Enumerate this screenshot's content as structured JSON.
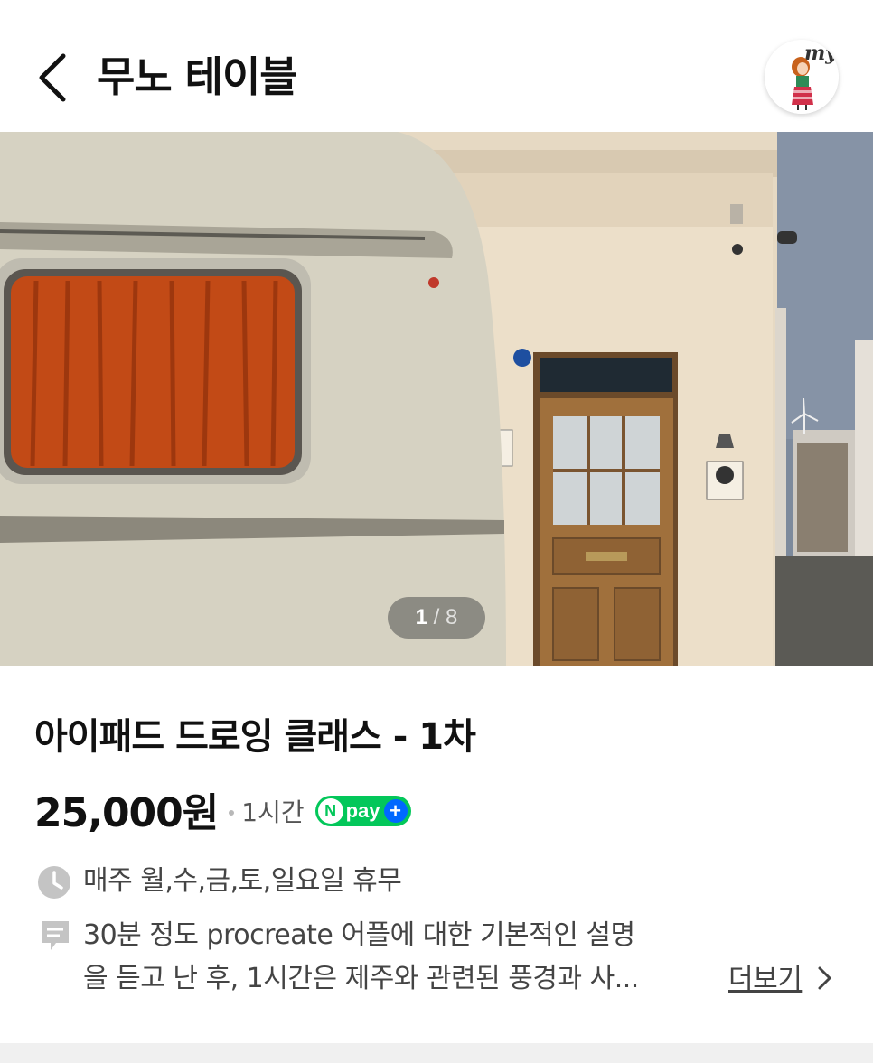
{
  "header": {
    "title": "무노 테이블",
    "back_icon": "chevron-left-icon",
    "avatar_text": "my"
  },
  "gallery": {
    "current": "1",
    "separator": "/",
    "total": "8"
  },
  "product": {
    "title": "아이패드 드로잉 클래스 - 1차",
    "price": "25,000원",
    "duration": "1시간",
    "npay_n": "N",
    "npay_word": "pay",
    "npay_plus": "+"
  },
  "info": {
    "hours_icon": "clock-icon",
    "hours": "매주 월,수,금,토,일요일 휴무",
    "desc_icon": "note-icon",
    "desc_line1": "30분 정도 procreate 어플에 대한 기본적인 설명",
    "desc_line2": "을 듣고 난 후, 1시간은 제주와 관련된 풍경과 사...",
    "more_label": "더보기"
  },
  "colors": {
    "npay_green": "#03c75a",
    "npay_blue": "#0068ff",
    "text_primary": "#111111",
    "text_secondary": "#444444"
  }
}
